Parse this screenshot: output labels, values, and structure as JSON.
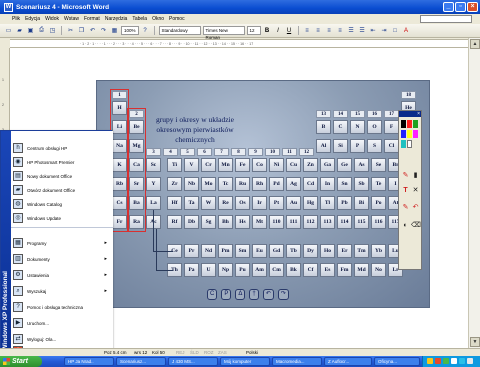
{
  "window": {
    "title": "Scenariusz 4 - Microsoft Word",
    "icon_label": "W",
    "min_label": "_",
    "restore_label": "▫",
    "close_label": "×"
  },
  "menu": [
    "Plik",
    "Edycja",
    "Widok",
    "Wstaw",
    "Format",
    "Narzędzia",
    "Tabela",
    "Okno",
    "Pomoc"
  ],
  "toolbar": {
    "zoom": "100%",
    "style": "Standardowy",
    "font": "Times New Roman",
    "size": "12",
    "bold": "B",
    "italic": "I",
    "underline": "U"
  },
  "ruler_text": "· 1 · 2 · 1 · · · · 1 · · · 2 · · · 3 · · · 4 · · · 5 · · · 6 · · · 7 · · · 8 · · · 9 · · 10 · · 11 · · 12 · · 13 · · 14 · · 15 · · 16 · · 17",
  "vruler": [
    "1",
    "2",
    "3",
    "4",
    "5",
    "6",
    "7",
    "8",
    "9",
    "10",
    "11"
  ],
  "slide": {
    "title": "grupy i okresy w układzie okresowym pierwiastków chemicznych",
    "groups_left": [
      "1",
      "2"
    ],
    "groups_mid": [
      "3",
      "4",
      "5",
      "6",
      "7",
      "8",
      "9",
      "10",
      "11",
      "12"
    ],
    "groups_right": [
      "13",
      "14",
      "15",
      "16",
      "17",
      "18"
    ],
    "row1": [
      "H",
      "He"
    ],
    "row2_left": [
      "Li",
      "Be"
    ],
    "row2_right": [
      "B",
      "C",
      "N",
      "O",
      "F",
      "Ne"
    ],
    "row3_left": [
      "Na",
      "Mg"
    ],
    "row3_right": [
      "Al",
      "Si",
      "P",
      "S",
      "Cl",
      "Ar"
    ],
    "row4": [
      "K",
      "Ca",
      "Sc",
      "Ti",
      "V",
      "Cr",
      "Mn",
      "Fe",
      "Co",
      "Ni",
      "Cu",
      "Zn",
      "Ga",
      "Ge",
      "As",
      "Se",
      "Br",
      "Kr"
    ],
    "row5": [
      "Rb",
      "Sr",
      "Y",
      "Zr",
      "Nb",
      "Mo",
      "Tc",
      "Ru",
      "Rh",
      "Pd",
      "Ag",
      "Cd",
      "In",
      "Sn",
      "Sb",
      "Te",
      "I",
      "Xe"
    ],
    "row6": [
      "Cs",
      "Ba",
      "La",
      "Hf",
      "Ta",
      "W",
      "Re",
      "Os",
      "Ir",
      "Pt",
      "Au",
      "Hg",
      "Tl",
      "Pb",
      "Bi",
      "Po",
      "At",
      "Rn"
    ],
    "row7": [
      "Fr",
      "Ra",
      "Ac",
      "Rf",
      "Db",
      "Sg",
      "Bh",
      "Hs",
      "Mt",
      "110",
      "111",
      "112",
      "113",
      "114",
      "115",
      "116",
      "117",
      "118"
    ],
    "lanthanides": [
      "Ce",
      "Pr",
      "Nd",
      "Pm",
      "Sm",
      "Eu",
      "Gd",
      "Tb",
      "Dy",
      "Ho",
      "Er",
      "Tm",
      "Yb",
      "Lu"
    ],
    "actinides": [
      "Th",
      "Pa",
      "U",
      "Np",
      "Pu",
      "Am",
      "Cm",
      "Bk",
      "Cf",
      "Es",
      "Fm",
      "Md",
      "No",
      "Lr"
    ],
    "periods": [
      "1",
      "2",
      "3",
      "4",
      "5",
      "6",
      "7"
    ],
    "nav": [
      "C",
      "P",
      "Δ",
      "†",
      "↶",
      "↷"
    ]
  },
  "palette_close": "×",
  "palette_colors": [
    "#000000",
    "#ff2020",
    "#20a020",
    "#2020ff",
    "#ffff20",
    "#ff20ff",
    "#20c0c0",
    "#ffffff"
  ],
  "palette_tools": [
    "T",
    "✕",
    "✎",
    "↶",
    "◐",
    "⌫"
  ],
  "start_menu": {
    "strip_text": "Windows XP Professional",
    "pinned": [
      "Centrum obsługi HP",
      "HP Photosmart Premier",
      "Nowy dokument Office",
      "Otwórz dokument Office",
      "Windows Catalog",
      "Windows Update"
    ],
    "lower": [
      "Programy",
      "Dokumenty",
      "Ustawienia",
      "Wyszukaj",
      "Pomoc i obsługa techniczna",
      "Uruchom...",
      "Wyloguj: Ola...",
      "Wyłącz komputer..."
    ],
    "arrow": "▸"
  },
  "statusbar": {
    "pos": "Poz 5.4 cm",
    "line": "wrs 12",
    "col": "Kol 50",
    "modes": [
      "REJ",
      "ŚLD",
      "ROZ",
      "ZAS"
    ],
    "lang": "Polski"
  },
  "taskbar": {
    "start": "Start",
    "tasks": [
      "HP Ja Nrad..",
      "Scenariusz...",
      "J 430 MS...",
      "Mój komputer",
      "Macromedia...",
      "Z Auflocr...",
      "Oficyna..."
    ]
  }
}
